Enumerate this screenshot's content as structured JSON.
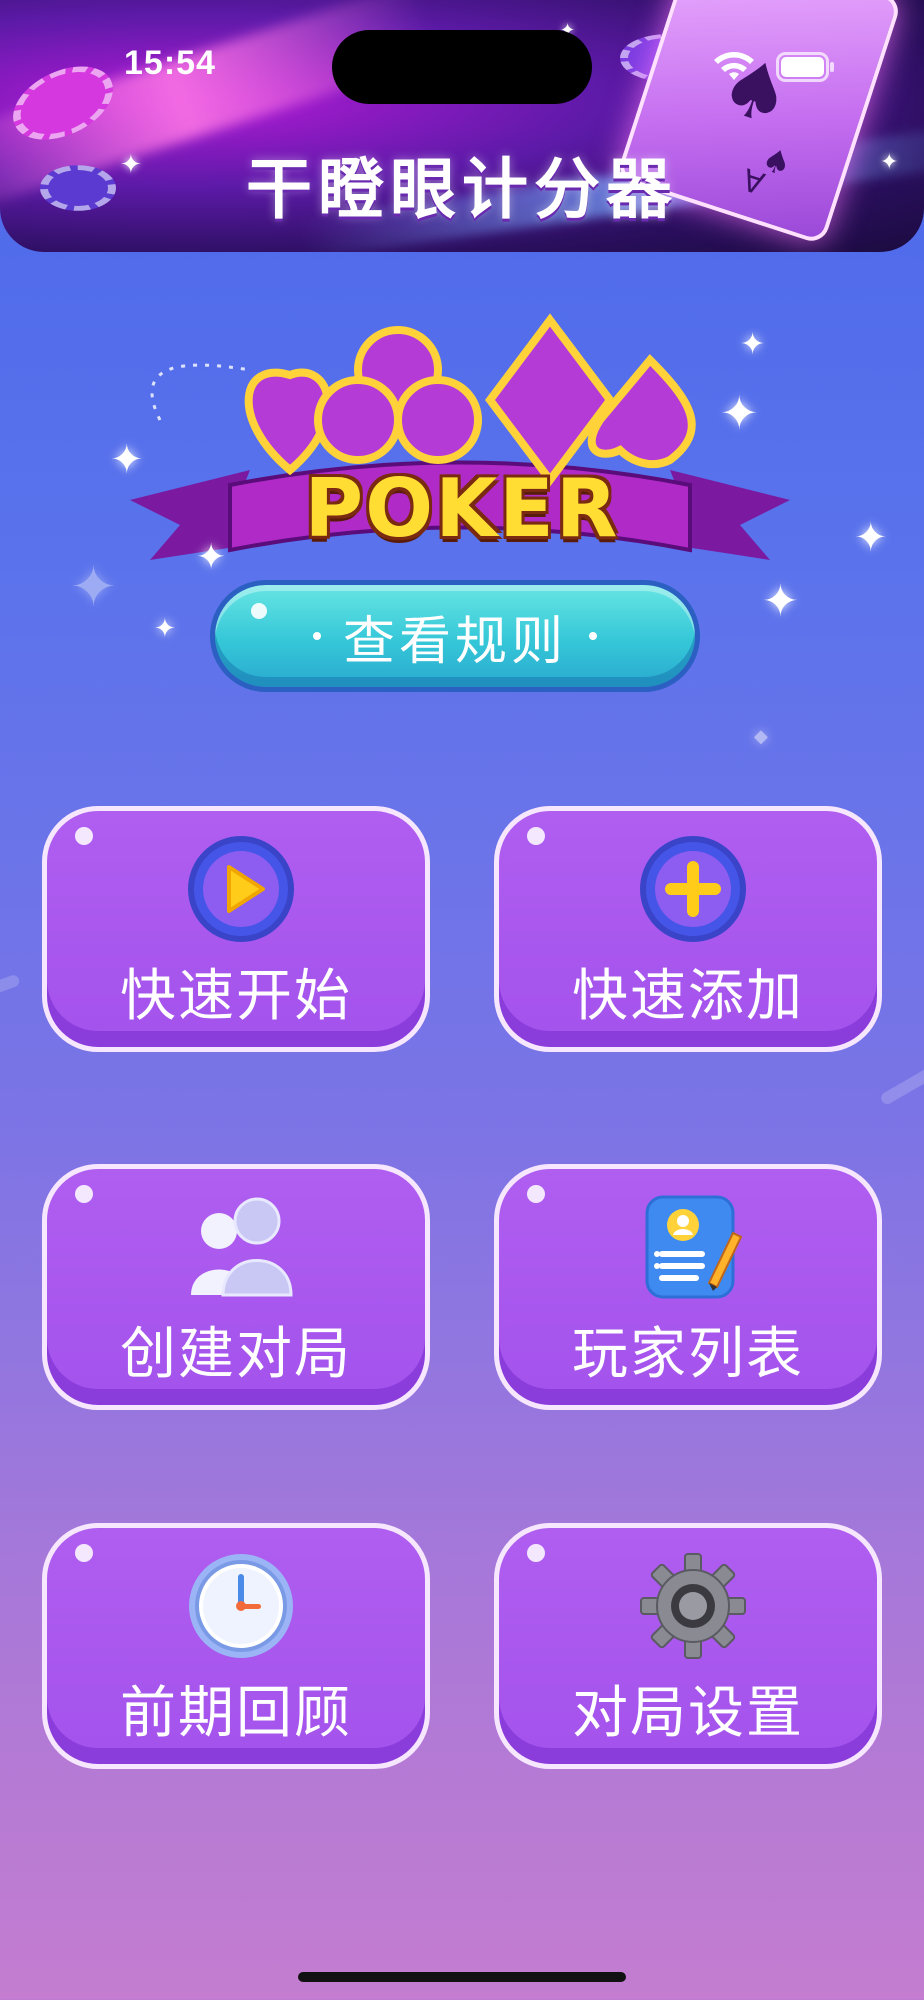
{
  "status_bar": {
    "time": "15:54"
  },
  "header": {
    "title": "干瞪眼计分器"
  },
  "logo": {
    "text": "POKER"
  },
  "rules_button": {
    "label": "查看规则"
  },
  "menu": {
    "items": [
      {
        "id": "quick-start",
        "label": "快速开始",
        "icon": "play-icon"
      },
      {
        "id": "quick-add",
        "label": "快速添加",
        "icon": "plus-icon"
      },
      {
        "id": "create-match",
        "label": "创建对局",
        "icon": "users-icon"
      },
      {
        "id": "player-list",
        "label": "玩家列表",
        "icon": "contact-card-icon"
      },
      {
        "id": "history",
        "label": "前期回顾",
        "icon": "clock-icon"
      },
      {
        "id": "settings",
        "label": "对局设置",
        "icon": "gear-icon"
      }
    ]
  },
  "colors": {
    "background_top": "#4a66ea",
    "background_bottom": "#c47dd0",
    "card_fill": "#a352ec",
    "card_border": "#f6e7ff",
    "rules_button": "#35c7d8",
    "logo_text": "#ffdd33"
  }
}
